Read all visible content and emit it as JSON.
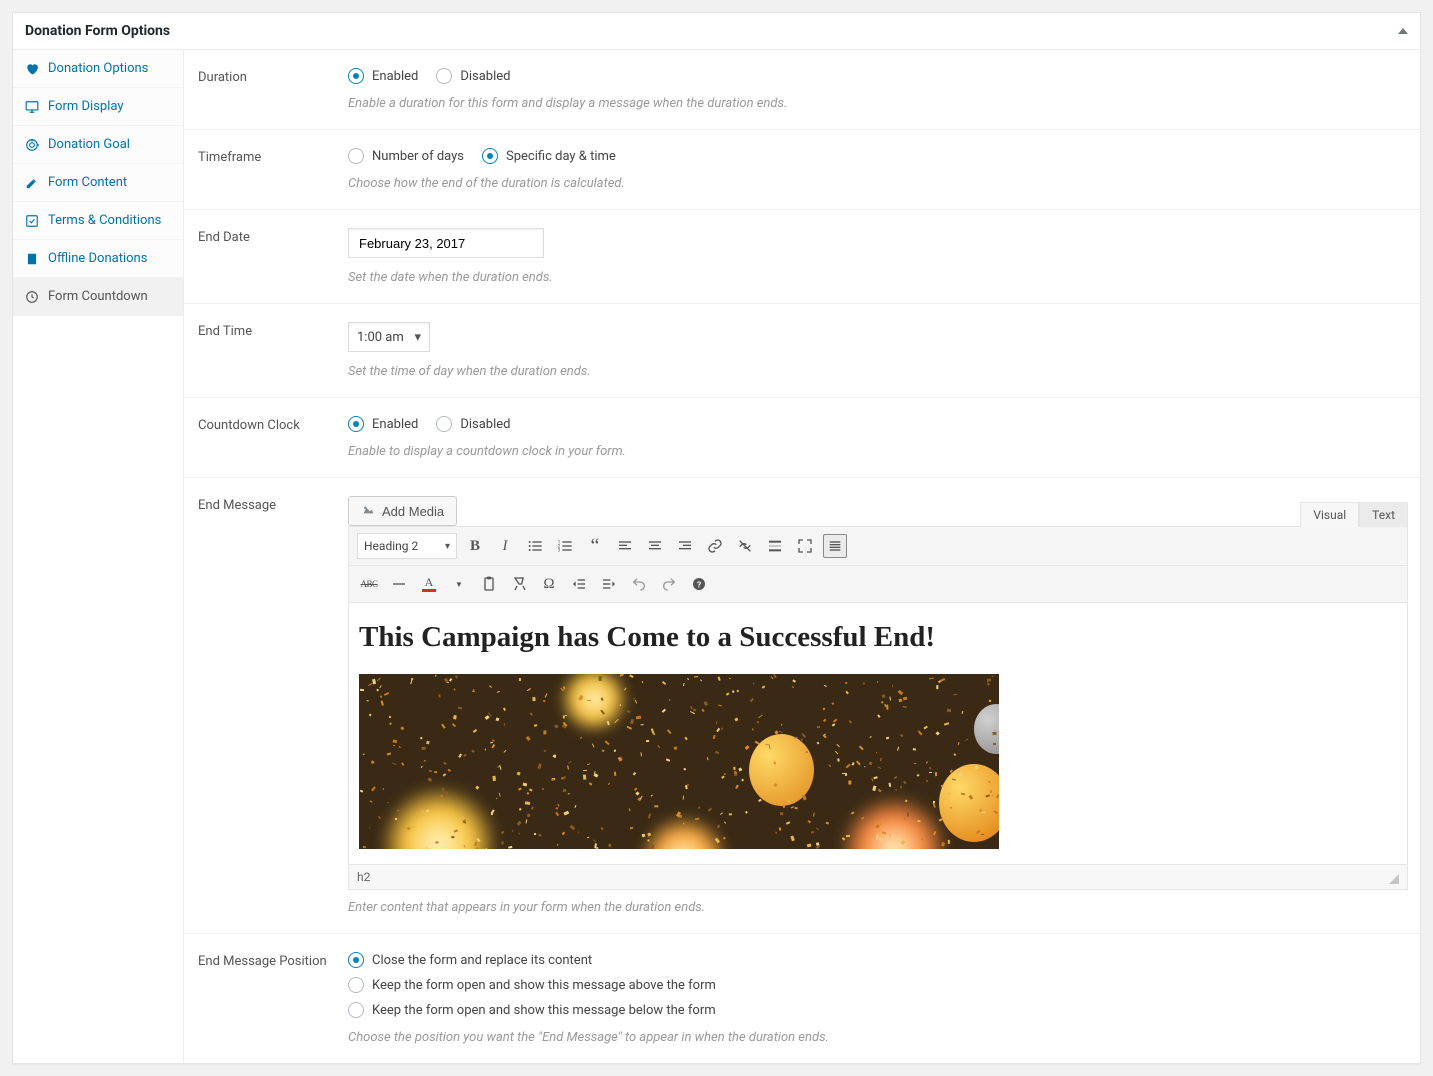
{
  "panel_title": "Donation Form Options",
  "sidebar": {
    "items": [
      {
        "label": "Donation Options"
      },
      {
        "label": "Form Display"
      },
      {
        "label": "Donation Goal"
      },
      {
        "label": "Form Content"
      },
      {
        "label": "Terms & Conditions"
      },
      {
        "label": "Offline Donations"
      },
      {
        "label": "Form Countdown"
      }
    ]
  },
  "fields": {
    "duration": {
      "label": "Duration",
      "opts": {
        "enabled": "Enabled",
        "disabled": "Disabled"
      },
      "hint": "Enable a duration for this form and display a message when the duration ends."
    },
    "timeframe": {
      "label": "Timeframe",
      "opts": {
        "days": "Number of days",
        "specific": "Specific day & time"
      },
      "hint": "Choose how the end of the duration is calculated."
    },
    "end_date": {
      "label": "End Date",
      "value": "February 23, 2017",
      "hint": "Set the date when the duration ends."
    },
    "end_time": {
      "label": "End Time",
      "value": "1:00 am",
      "hint": "Set the time of day when the duration ends."
    },
    "countdown": {
      "label": "Countdown Clock",
      "opts": {
        "enabled": "Enabled",
        "disabled": "Disabled"
      },
      "hint": "Enable to display a countdown clock in your form."
    },
    "end_message": {
      "label": "End Message",
      "add_media": "Add Media",
      "tab_visual": "Visual",
      "tab_text": "Text",
      "format": "Heading 2",
      "content_h2": "This Campaign has Come to a Successful End!",
      "status": "h2",
      "hint": "Enter content that appears in your form when the duration ends."
    },
    "position": {
      "label": "End Message Position",
      "opts": {
        "close": "Close the form and replace its content",
        "above": "Keep the form open and show this message above the form",
        "below": "Keep the form open and show this message below the form"
      },
      "hint": "Choose the position you want the \"End Message\" to appear in when the duration ends."
    }
  }
}
